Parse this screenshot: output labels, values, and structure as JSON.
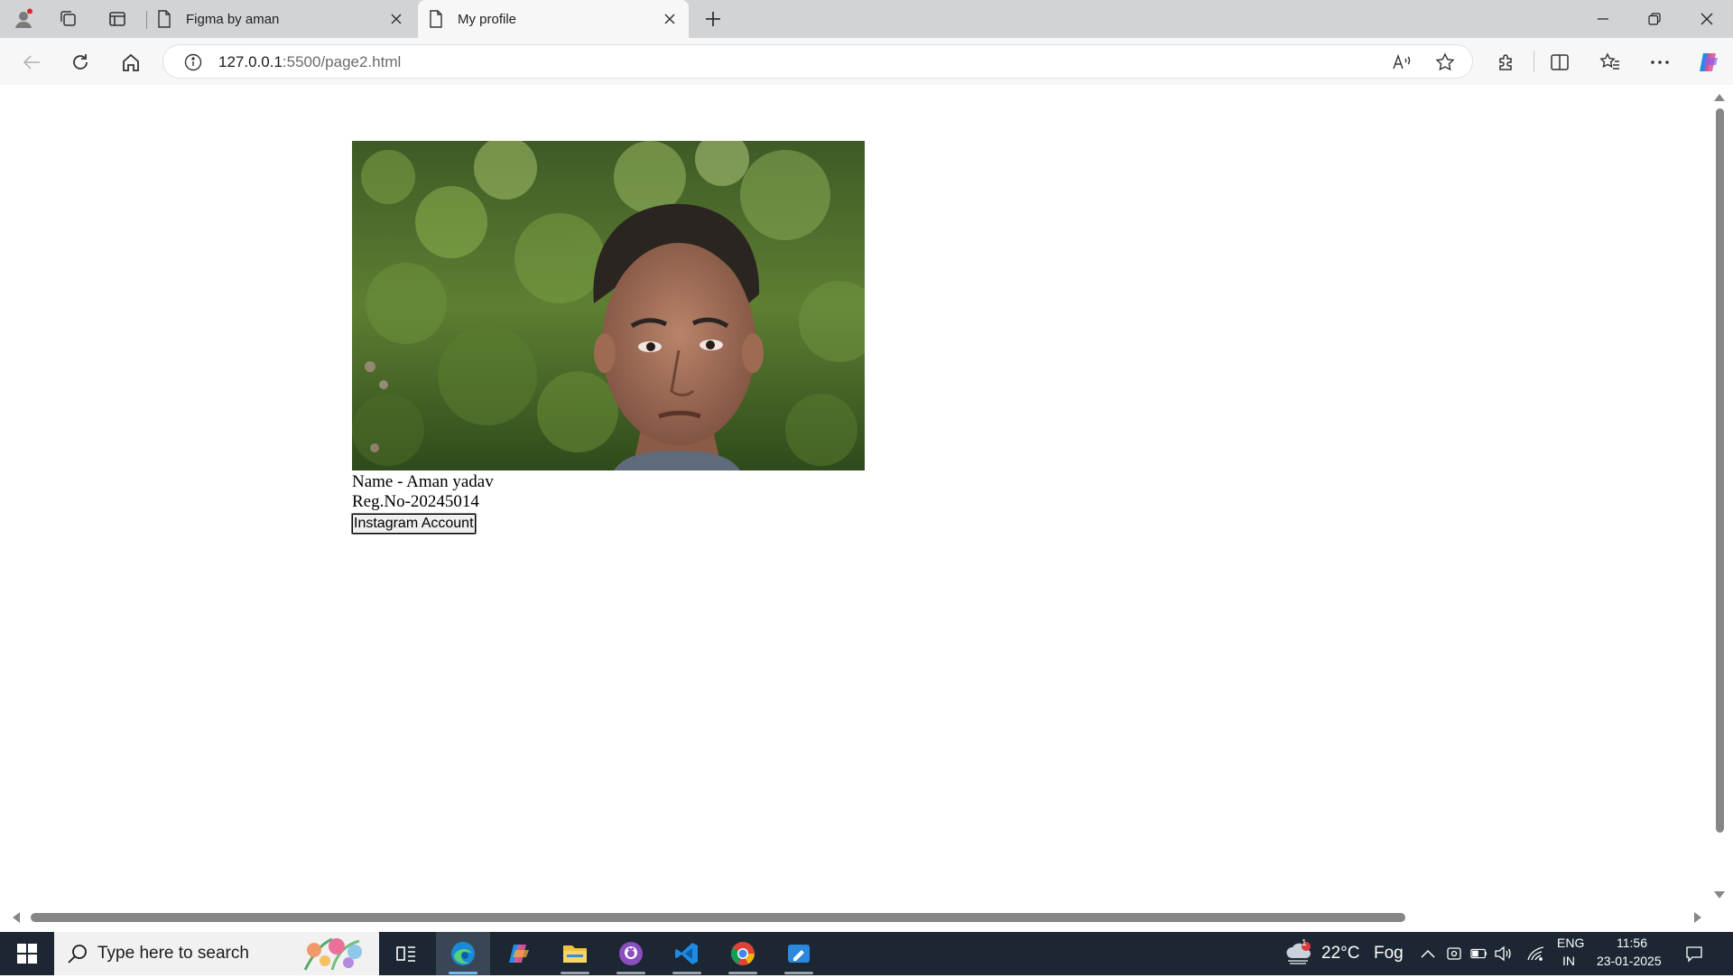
{
  "browser": {
    "tabs": [
      {
        "label": "Figma by aman",
        "active": false
      },
      {
        "label": "My profile",
        "active": true
      }
    ],
    "url_host": "127.0.0.1",
    "url_rest": ":5500/page2.html"
  },
  "page": {
    "name_line": "Name - Aman yadav",
    "reg_line": "Reg.No-20245014",
    "instagram_button": "Instagram Account"
  },
  "taskbar": {
    "search_placeholder": "Type here to search",
    "weather_temp": "22°C",
    "weather_desc": "Fog",
    "weather_badge": "1",
    "lang_top": "ENG",
    "lang_bottom": "IN",
    "time": "11:56",
    "date": "23-01-2025"
  },
  "colors": {
    "tabstrip_bg": "#d2d3d6",
    "taskbar_bg": "#1c2733",
    "edge_accent": "#0f7bd8"
  }
}
